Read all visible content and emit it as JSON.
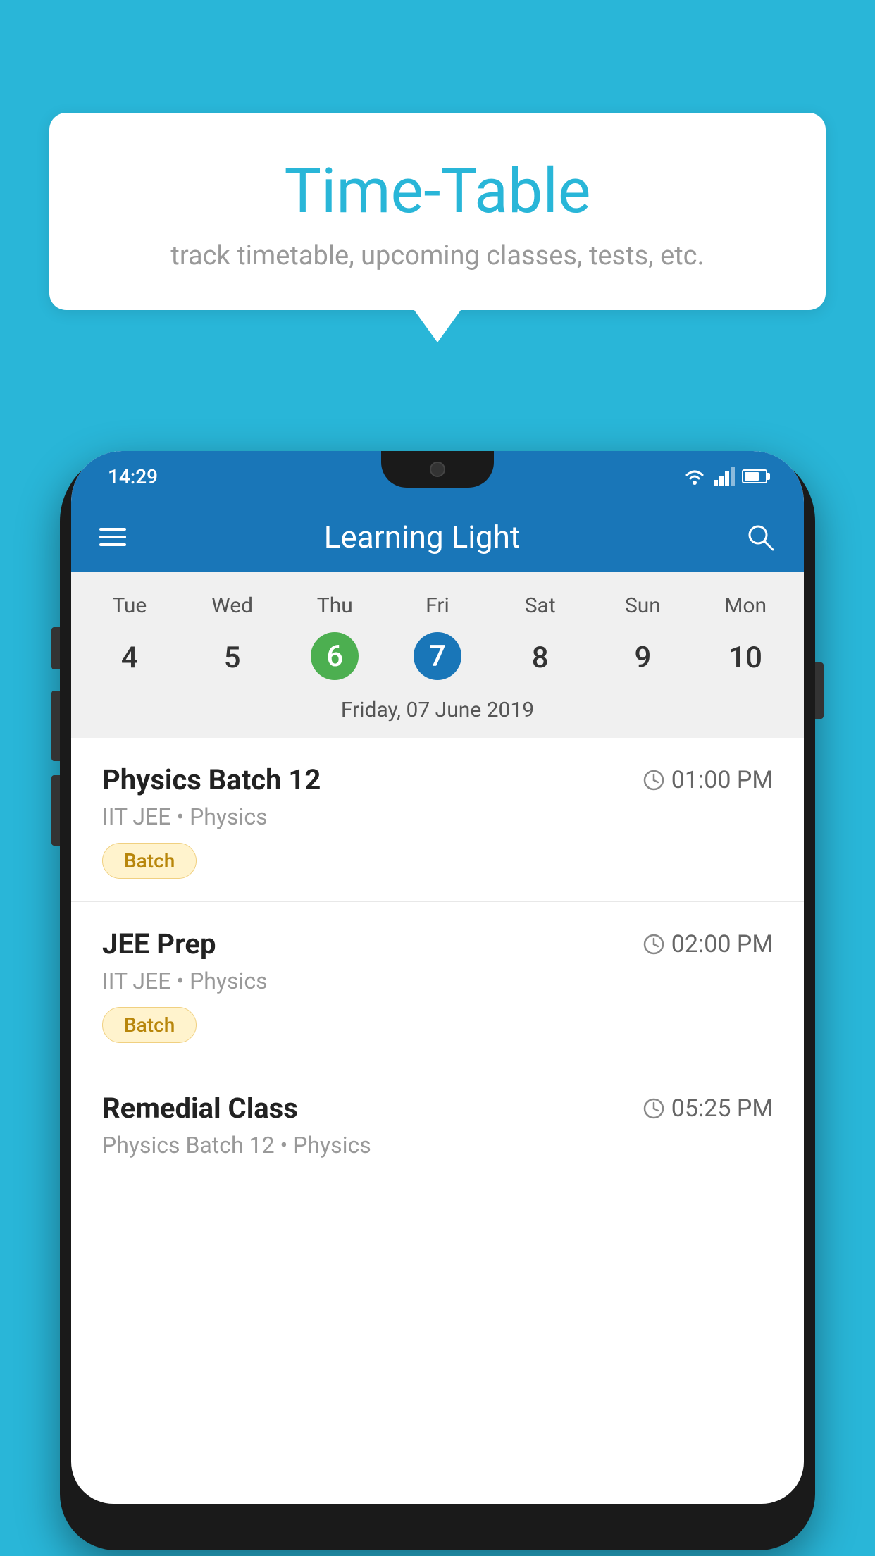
{
  "background_color": "#29B6D8",
  "card": {
    "title": "Time-Table",
    "subtitle": "track timetable, upcoming classes, tests, etc."
  },
  "app": {
    "status_time": "14:29",
    "title": "Learning Light",
    "hamburger_label": "menu",
    "search_label": "search"
  },
  "calendar": {
    "days": [
      "Tue",
      "Wed",
      "Thu",
      "Fri",
      "Sat",
      "Sun",
      "Mon"
    ],
    "dates": [
      "4",
      "5",
      "6",
      "7",
      "8",
      "9",
      "10"
    ],
    "today_index": 2,
    "selected_index": 3,
    "selected_date_label": "Friday, 07 June 2019"
  },
  "classes": [
    {
      "name": "Physics Batch 12",
      "time": "01:00 PM",
      "subtitle": "IIT JEE • Physics",
      "badge": "Batch"
    },
    {
      "name": "JEE Prep",
      "time": "02:00 PM",
      "subtitle": "IIT JEE • Physics",
      "badge": "Batch"
    },
    {
      "name": "Remedial Class",
      "time": "05:25 PM",
      "subtitle": "Physics Batch 12 • Physics",
      "badge": ""
    }
  ]
}
